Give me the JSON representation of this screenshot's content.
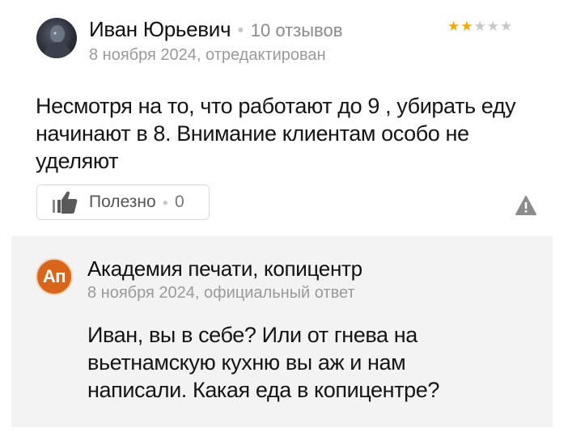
{
  "review": {
    "author_name": "Иван Юрьевич",
    "reviews_count": "10 отзывов",
    "date_line": "8 ноября 2024, отредактирован",
    "rating": 2,
    "rating_max": 5,
    "text": "Несмотря на то, что работают до 9 , убирать еду начинают в 8. Внимание клиентам особо не уделяют",
    "helpful_label": "Полезно",
    "helpful_count": "0",
    "icons": {
      "helpful": "thumbs-up-icon",
      "report": "warning-triangle-icon"
    }
  },
  "reply": {
    "avatar_initials": "Ап",
    "org_name": "Академия печати, копицентр",
    "meta": "8 ноября 2024, официальный ответ",
    "text": "Иван, вы в себе? Или от гнева на вьетнамскую кухню вы аж и нам написали. Какая еда в копицентре?"
  },
  "colors": {
    "star_on": "#f2a900",
    "star_off": "#c7c7c7",
    "org_avatar": "#d9651a",
    "reply_background": "#f3f3f3"
  }
}
